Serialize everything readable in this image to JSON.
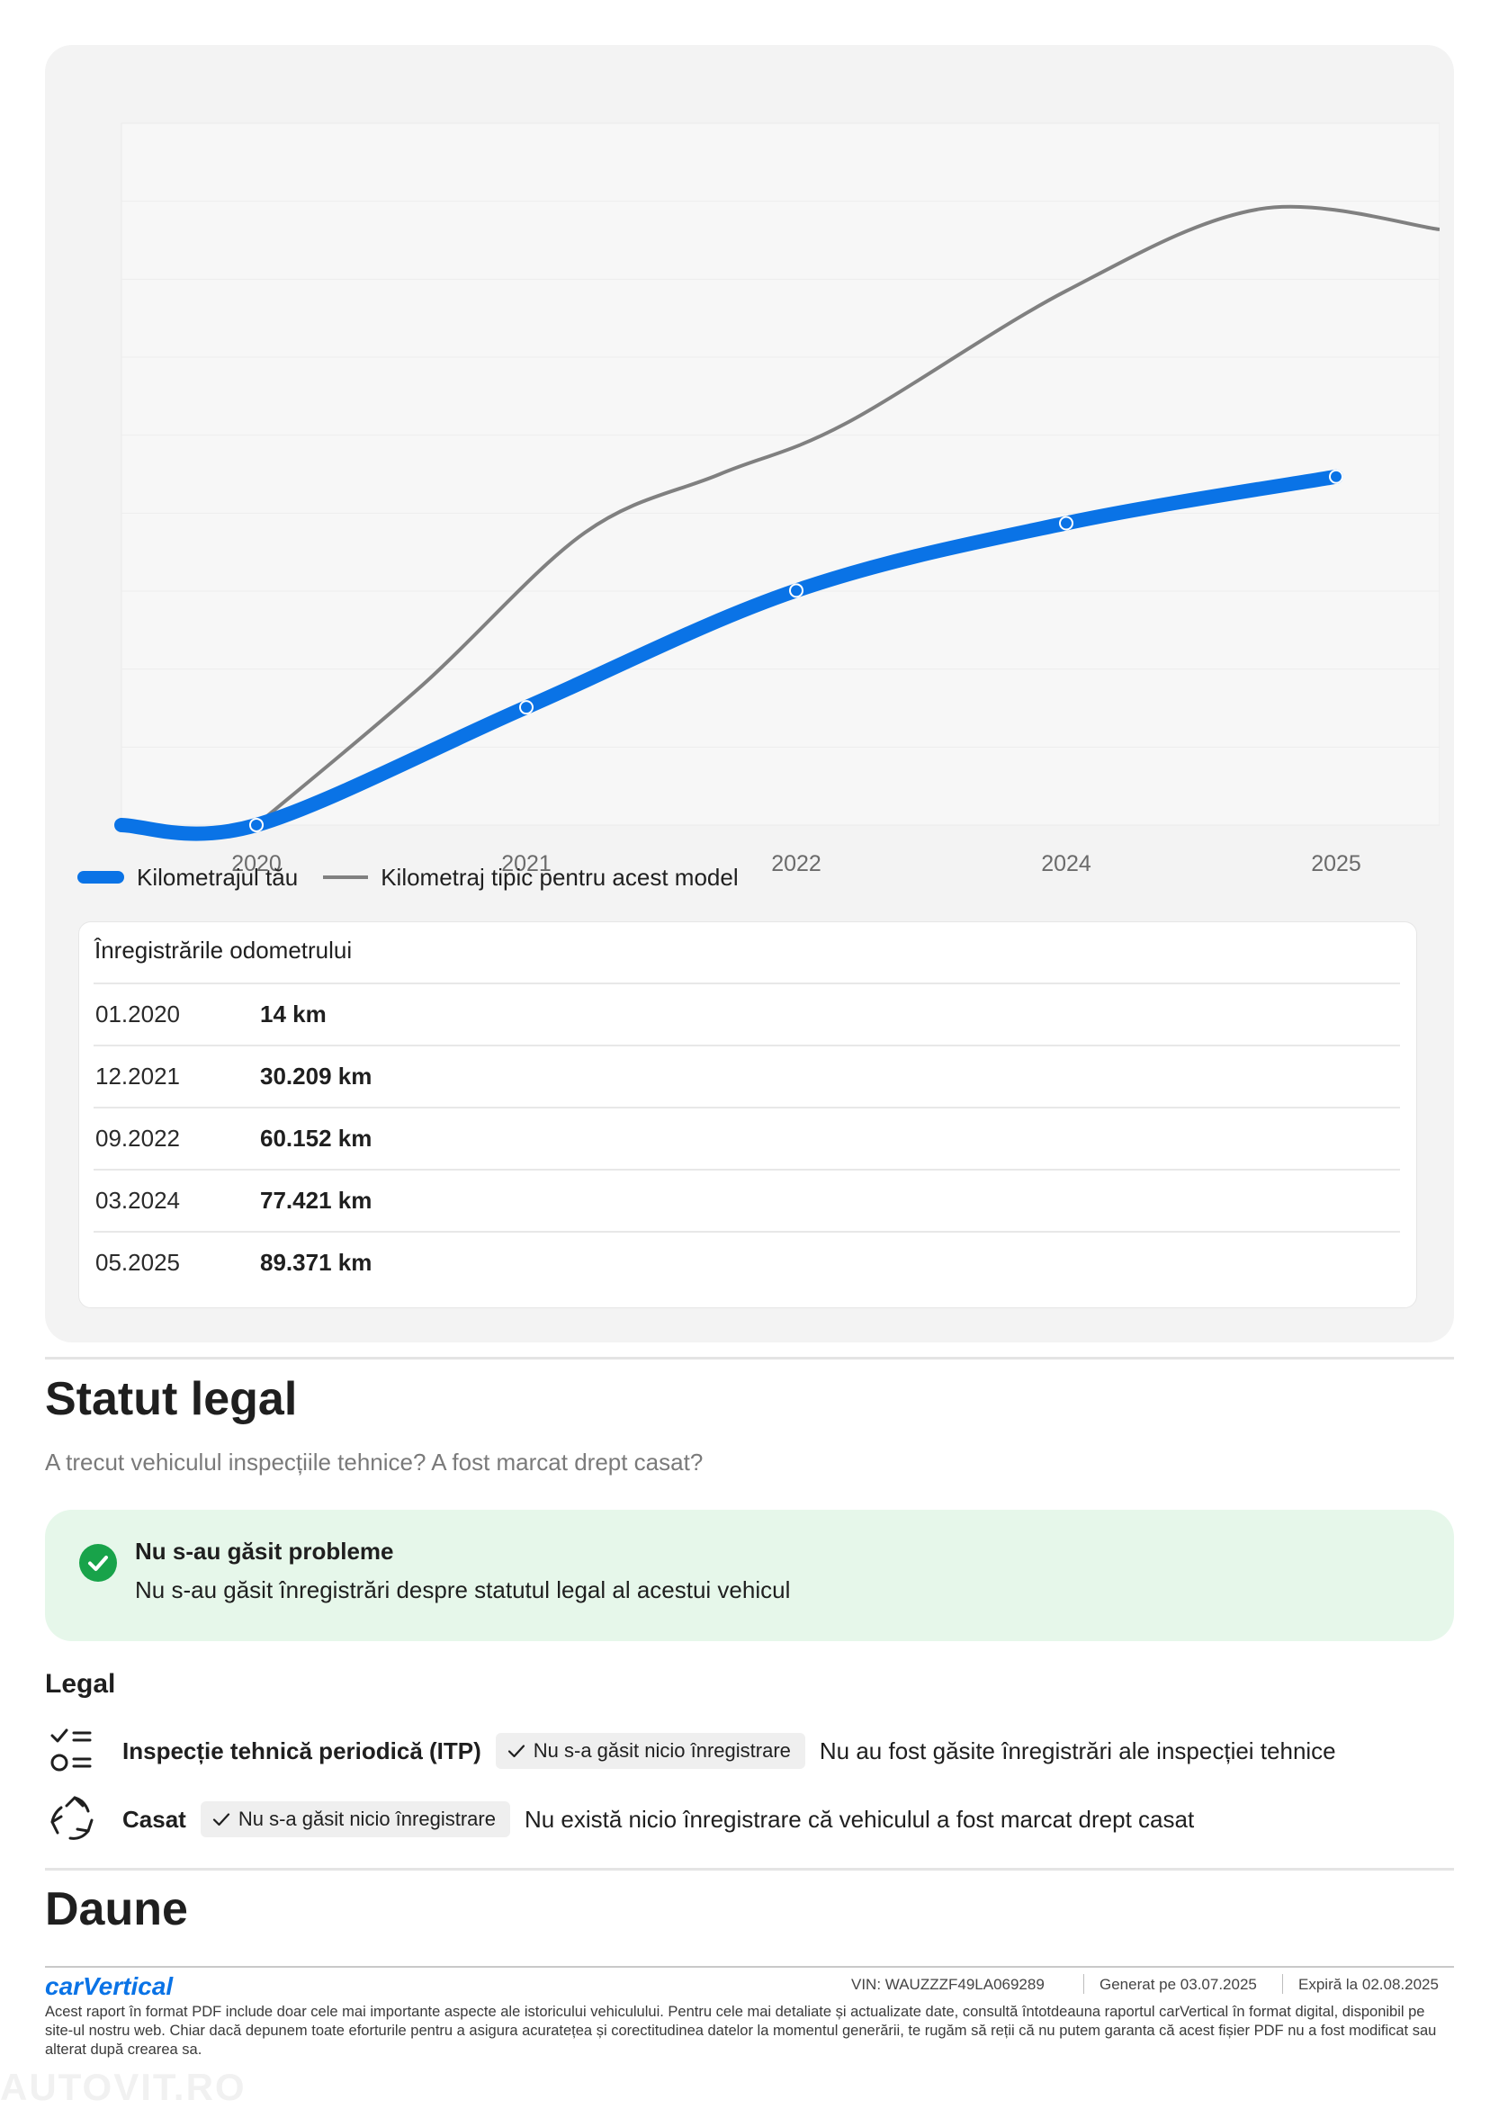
{
  "chart_data": {
    "type": "line",
    "x_tick_labels": [
      "2020",
      "2021",
      "2022",
      "2024",
      "2025"
    ],
    "series": [
      {
        "name": "Kilometrajul tău",
        "color": "#0a73e6",
        "points": [
          {
            "x": "01.2020",
            "km": 14
          },
          {
            "x": "12.2021",
            "km": 30209
          },
          {
            "x": "09.2022",
            "km": 60152
          },
          {
            "x": "03.2024",
            "km": 77421
          },
          {
            "x": "05.2025",
            "km": 89371
          }
        ]
      },
      {
        "name": "Kilometraj tipic pentru acest model",
        "color": "#808080"
      }
    ],
    "grid": true
  },
  "legend": {
    "yours": "Kilometrajul tău",
    "typical": "Kilometraj tipic pentru acest model"
  },
  "odometer": {
    "title": "Înregistrările odometrului",
    "rows": [
      {
        "date": "01.2020",
        "km": "14 km"
      },
      {
        "date": "12.2021",
        "km": "30.209 km"
      },
      {
        "date": "09.2022",
        "km": "60.152 km"
      },
      {
        "date": "03.2024",
        "km": "77.421 km"
      },
      {
        "date": "05.2025",
        "km": "89.371 km"
      }
    ]
  },
  "legal_status": {
    "title": "Statut legal",
    "subtitle": "A trecut vehiculul inspecțiile tehnice? A fost marcat drept casat?",
    "banner_title": "Nu s-au găsit probleme",
    "banner_desc": "Nu s-au găsit înregistrări despre statutul legal al acestui vehicul",
    "section_label": "Legal",
    "items": [
      {
        "icon": "checklist-icon",
        "name": "Inspecție tehnică periodică (ITP)",
        "chip": "Nu s-a găsit nicio înregistrare",
        "desc": "Nu au fost găsite înregistrări ale inspecției tehnice"
      },
      {
        "icon": "recycle-icon",
        "name": "Casat",
        "chip": "Nu s-a găsit nicio înregistrare",
        "desc": "Nu există nicio înregistrare că vehiculul a fost marcat drept casat"
      }
    ]
  },
  "damages": {
    "title": "Daune"
  },
  "footer": {
    "brand": "carVertical",
    "vin_label": "VIN:",
    "vin": "WAUZZZF49LA069289",
    "generated_label": "Generat pe",
    "generated": "03.07.2025",
    "expires_label": "Expiră la",
    "expires": "02.08.2025",
    "disclaimer": "Acest raport în format PDF include doar cele mai importante aspecte ale istoricului vehiculului. Pentru cele mai detaliate și actualizate date, consultă întotdeauna raportul carVertical în format digital, disponibil pe site-ul nostru web. Chiar dacă depunem toate eforturile pentru a asigura acuratețea și corectitudinea datelor la momentul generării, te rugăm să reții că nu putem garanta că acest fișier PDF nu a fost modificat sau alterat după crearea sa.",
    "watermark": "AUTOVIT.RO"
  },
  "colors": {
    "accent": "#0a73e6",
    "success": "#18a34a",
    "success_bg": "#e6f7ea"
  }
}
